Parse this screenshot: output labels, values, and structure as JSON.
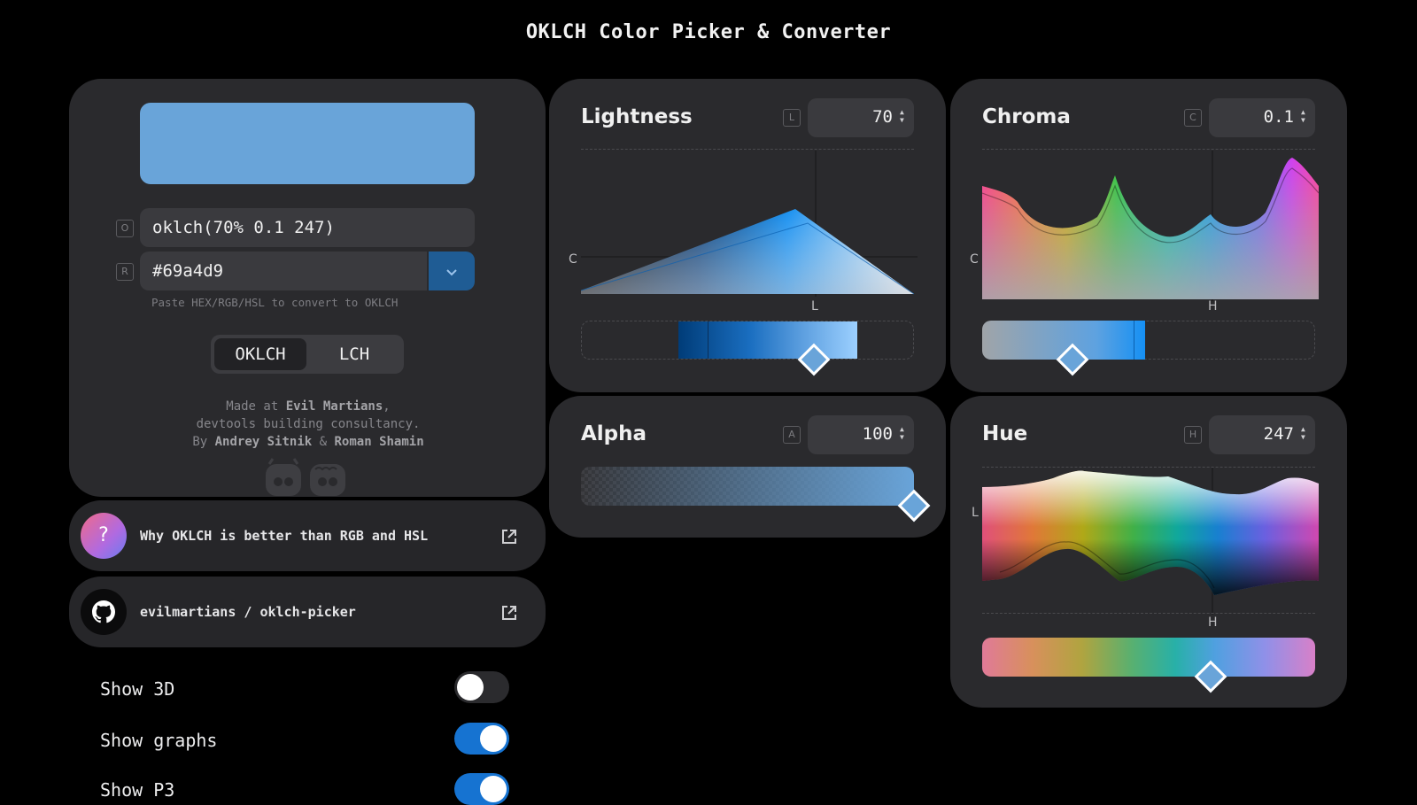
{
  "app": {
    "title": "OKLCH Color Picker & Converter"
  },
  "colors": {
    "current": "#69a4d9",
    "accent": "#1673d1",
    "background": "#000000",
    "card": "#2a2a2d"
  },
  "converter": {
    "oklch_key": "O",
    "oklch_value": "oklch(70% 0.1 247)",
    "rgb_key": "R",
    "rgb_value": "#69a4d9",
    "hint": "Paste HEX/RGB/HSL to convert to OKLCH",
    "modes": [
      "OKLCH",
      "LCH"
    ],
    "active_mode": "OKLCH"
  },
  "credits": {
    "line1_prefix": "Made at ",
    "company": "Evil Martians",
    "line1_suffix": ",",
    "line2": "devtools building consultancy.",
    "line3_prefix": "By ",
    "author1": "Andrey Sitnik",
    "amp": " & ",
    "author2": "Roman Shamin"
  },
  "links": [
    {
      "label": "Why OKLCH is better than RGB and HSL",
      "icon": "question-icon",
      "badge": "?"
    },
    {
      "label": "evilmartians / oklch-picker",
      "icon": "github-icon"
    }
  ],
  "settings": [
    {
      "label": "Show 3D",
      "on": false
    },
    {
      "label": "Show graphs",
      "on": true
    },
    {
      "label": "Show P3",
      "on": true
    }
  ],
  "panels": {
    "lightness": {
      "title": "Lightness",
      "key": "L",
      "value": "70",
      "axis_y": "C",
      "axis_x": "L"
    },
    "chroma": {
      "title": "Chroma",
      "key": "C",
      "value": "0.1",
      "axis_y": "C",
      "axis_x": "H"
    },
    "alpha": {
      "title": "Alpha",
      "key": "A",
      "value": "100"
    },
    "hue": {
      "title": "Hue",
      "key": "H",
      "value": "247",
      "axis_y": "L",
      "axis_x": "H"
    }
  }
}
